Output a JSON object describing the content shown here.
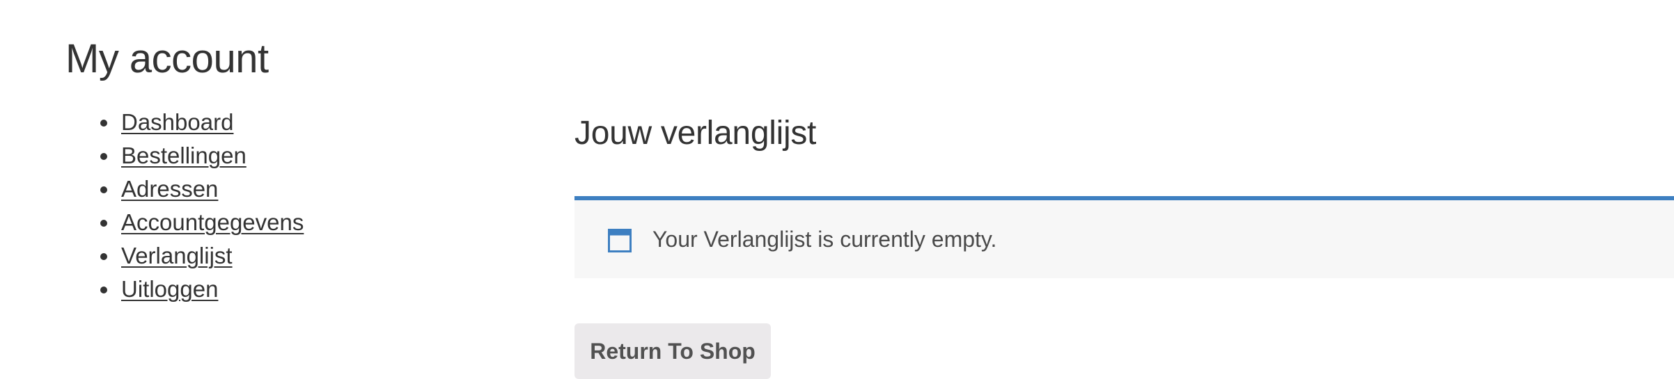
{
  "page": {
    "title": "My account"
  },
  "account_nav": {
    "items": [
      {
        "label": "Dashboard"
      },
      {
        "label": "Bestellingen"
      },
      {
        "label": "Adressen"
      },
      {
        "label": "Accountgegevens"
      },
      {
        "label": "Verlanglijst"
      },
      {
        "label": "Uitloggen"
      }
    ]
  },
  "wishlist": {
    "title": "Jouw verlanglijst",
    "notice": {
      "icon": "window-icon",
      "text": "Your Verlanglijst is currently empty.",
      "accent_color": "#3d7fc1"
    },
    "return_button_label": "Return To Shop"
  }
}
